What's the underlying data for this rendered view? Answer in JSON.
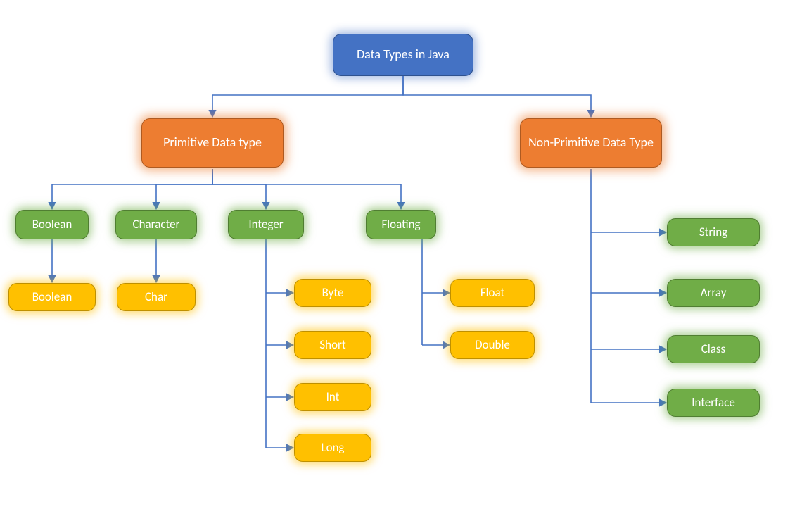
{
  "root": {
    "label": "Data Types in Java"
  },
  "primitive": {
    "label": "Primitive Data type",
    "categories": {
      "boolean": {
        "label": "Boolean",
        "leaves": [
          "Boolean"
        ]
      },
      "character": {
        "label": "Character",
        "leaves": [
          "Char"
        ]
      },
      "integer": {
        "label": "Integer",
        "leaves": [
          "Byte",
          "Short",
          "Int",
          "Long"
        ]
      },
      "floating": {
        "label": "Floating",
        "leaves": [
          "Float",
          "Double"
        ]
      }
    }
  },
  "nonprimitive": {
    "label": "Non-Primitive Data Type",
    "leaves": [
      "String",
      "Array",
      "Class",
      "Interface"
    ]
  },
  "colors": {
    "root": "#4472c4",
    "category": "#ed7d31",
    "group": "#70ad47",
    "leaf": "#ffc000",
    "connector": "#4472c4"
  }
}
